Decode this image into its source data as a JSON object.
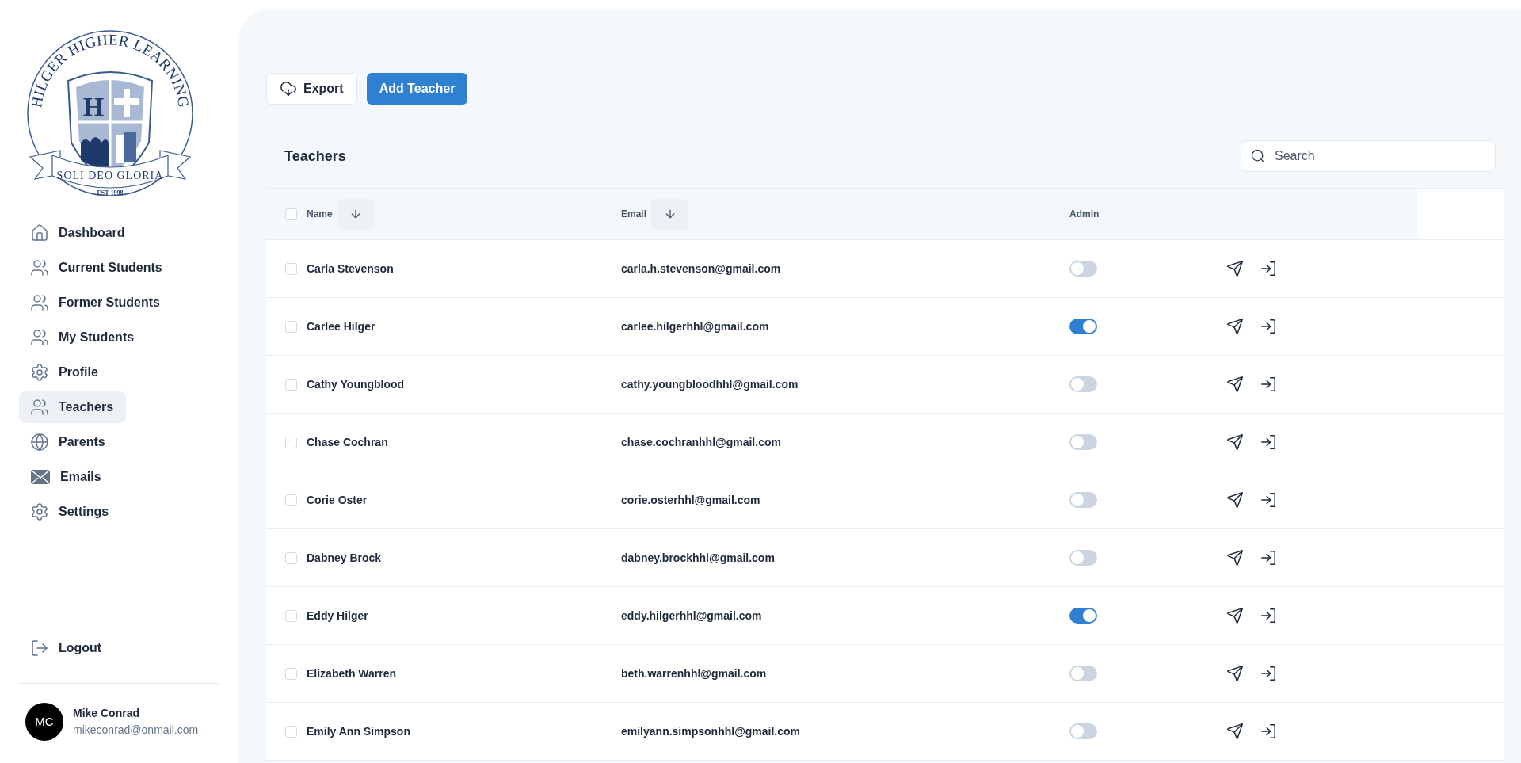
{
  "logo": {
    "title": "HILGER HIGHER LEARNING",
    "initial": "H",
    "motto": "SOLI DEO GLORIA",
    "established": "EST 1998"
  },
  "sidebar": {
    "items": [
      {
        "kind": "home",
        "label": "Dashboard",
        "selected": false
      },
      {
        "kind": "users",
        "label": "Current Students",
        "selected": false
      },
      {
        "kind": "users",
        "label": "Former Students",
        "selected": false
      },
      {
        "kind": "users",
        "label": "My Students",
        "selected": false
      },
      {
        "kind": "gear",
        "label": "Profile",
        "selected": false
      },
      {
        "kind": "users",
        "label": "Teachers",
        "selected": true
      },
      {
        "kind": "globe",
        "label": "Parents",
        "selected": false
      },
      {
        "kind": "mail",
        "label": "Emails",
        "selected": false
      },
      {
        "kind": "gear",
        "label": "Settings",
        "selected": false
      }
    ],
    "logout": "Logout",
    "user": {
      "initials": "MC",
      "name": "Mike Conrad",
      "email": "mikeconrad@onmail.com"
    }
  },
  "toolbar": {
    "export": "Export",
    "add": "Add Teacher"
  },
  "table": {
    "title": "Teachers",
    "search": {
      "placeholder": "Search"
    },
    "select_all": {
      "checked": false
    },
    "columns": [
      "Name",
      "Email",
      "Admin"
    ],
    "rows": [
      {
        "name": "Carla Stevenson",
        "email": "carla.h.stevenson@gmail.com",
        "admin": false,
        "checked": false
      },
      {
        "name": "Carlee Hilger",
        "email": "carlee.hilgerhhl@gmail.com",
        "admin": true,
        "checked": false
      },
      {
        "name": "Cathy Youngblood",
        "email": "cathy.youngbloodhhl@gmail.com",
        "admin": false,
        "checked": false
      },
      {
        "name": "Chase Cochran",
        "email": "chase.cochranhhl@gmail.com",
        "admin": false,
        "checked": false
      },
      {
        "name": "Corie Oster",
        "email": "corie.osterhhl@gmail.com",
        "admin": false,
        "checked": false
      },
      {
        "name": "Dabney Brock",
        "email": "dabney.brockhhl@gmail.com",
        "admin": false,
        "checked": false
      },
      {
        "name": "Eddy Hilger",
        "email": "eddy.hilgerhhl@gmail.com",
        "admin": true,
        "checked": false
      },
      {
        "name": "Elizabeth Warren",
        "email": "beth.warrenhhl@gmail.com",
        "admin": false,
        "checked": false
      },
      {
        "name": "Emily Ann Simpson",
        "email": "emilyann.simpsonhhl@gmail.com",
        "admin": false,
        "checked": false
      }
    ]
  }
}
